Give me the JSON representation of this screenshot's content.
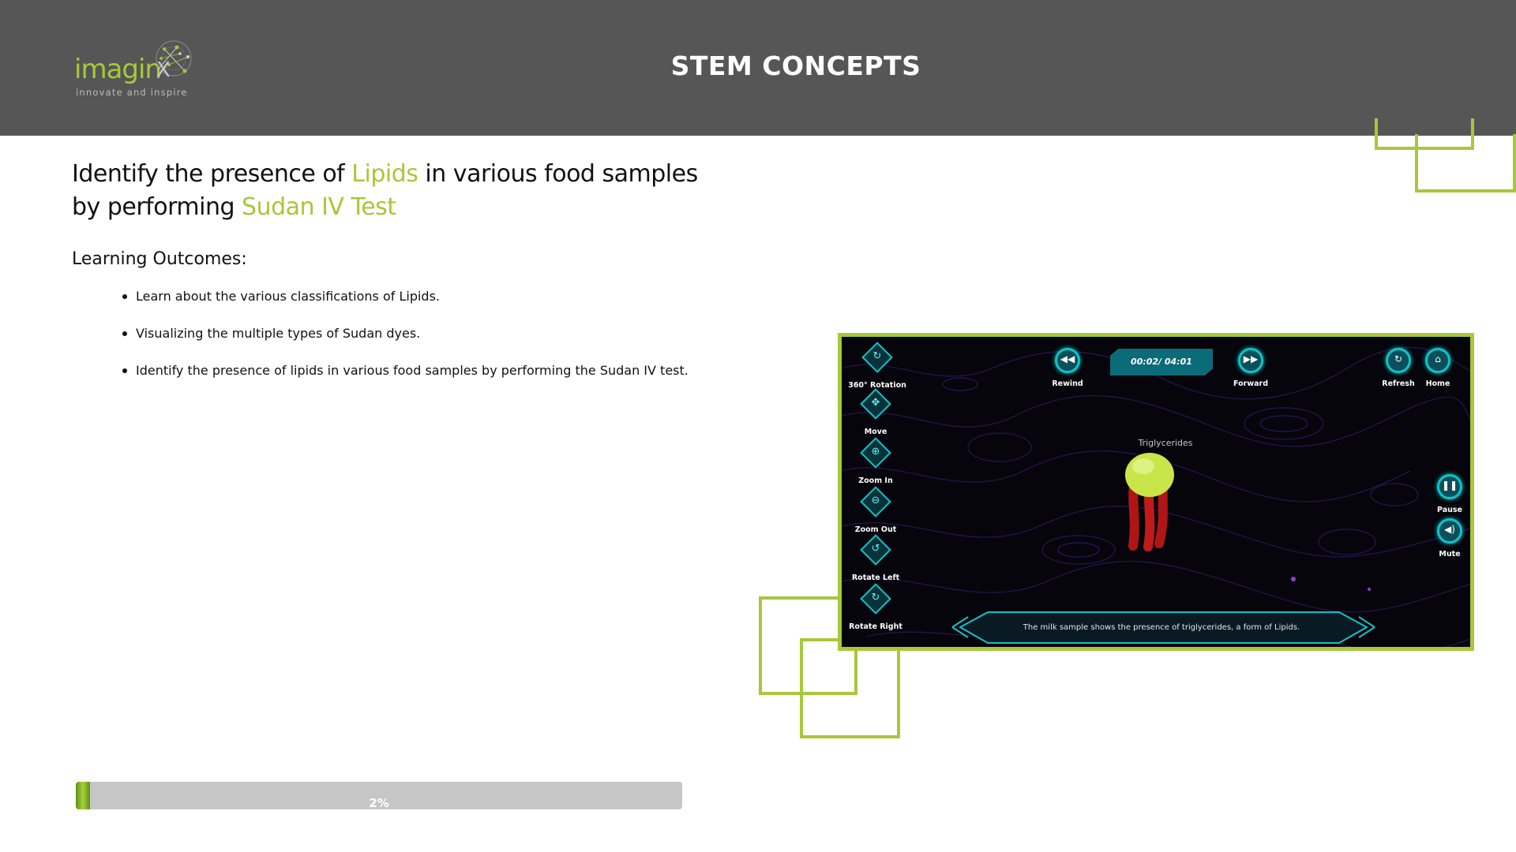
{
  "header": {
    "logo_text": "imagin",
    "logo_tagline": "innovate and inspire",
    "title": "STEM CONCEPTS"
  },
  "content": {
    "title_part1": "Identify the presence of ",
    "title_accent1": "Lipids",
    "title_part2": " in various food samples by performing ",
    "title_accent2": "Sudan IV Test",
    "learning_heading": "Learning Outcomes:",
    "outcomes": [
      "Learn about the various classifications of Lipids.",
      "Visualizing the multiple types of Sudan dyes.",
      "Identify the presence of lipids in various food samples by performing the Sudan IV test."
    ]
  },
  "progress": {
    "label": "2%",
    "value": 0.02
  },
  "viewer": {
    "tools": [
      {
        "label": "360° Rotation",
        "icon": "rotation-360-icon"
      },
      {
        "label": "Move",
        "icon": "move-icon"
      },
      {
        "label": "Zoom In",
        "icon": "zoom-in-icon"
      },
      {
        "label": "Zoom Out",
        "icon": "zoom-out-icon"
      },
      {
        "label": "Rotate Left",
        "icon": "rotate-left-icon"
      },
      {
        "label": "Rotate Right",
        "icon": "rotate-right-icon"
      }
    ],
    "rewind_label": "Rewind",
    "time": "00:02/ 04:01",
    "forward_label": "Forward",
    "refresh_label": "Refresh",
    "home_label": "Home",
    "pause_label": "Pause",
    "mute_label": "Mute",
    "model_label": "Triglycerides",
    "caption": "The milk sample shows the presence of triglycerides, a form of Lipids."
  },
  "colors": {
    "accent": "#a7c83a",
    "header_bg": "#565656",
    "cyan": "#0ec3c8"
  }
}
